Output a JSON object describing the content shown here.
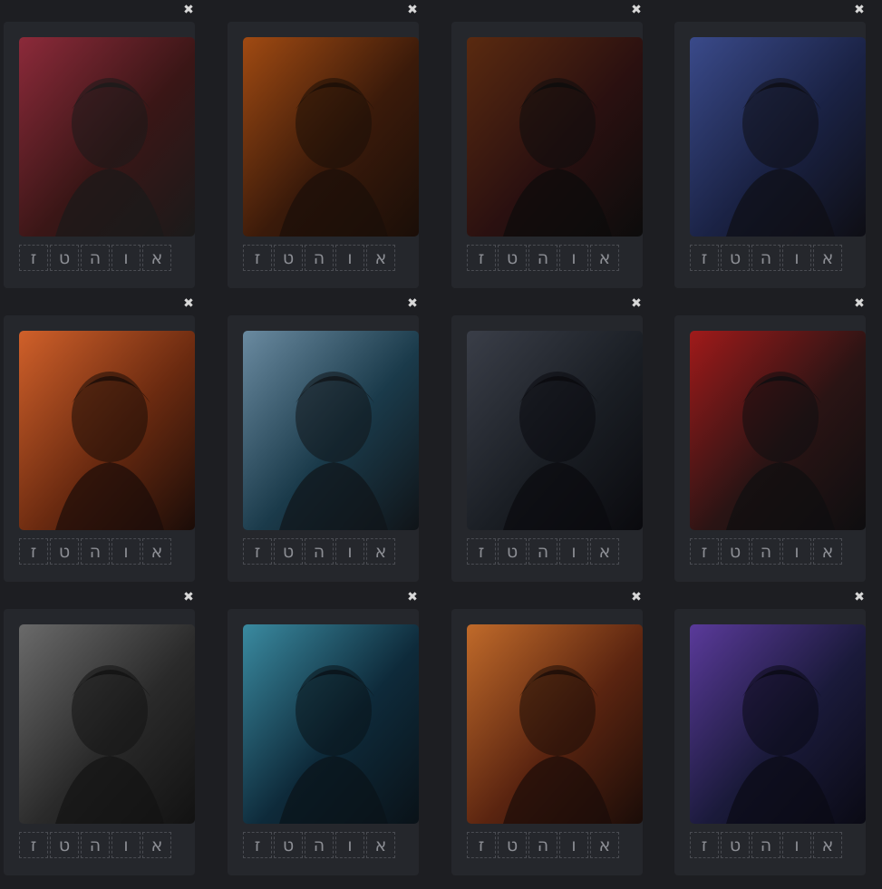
{
  "close_glyph": "✖",
  "key_labels": [
    "ז",
    "ט",
    "ה",
    "ו",
    "א"
  ],
  "cards": [
    {
      "palette": [
        "#3a1616",
        "#8c2a3a",
        "#1a1a1a"
      ],
      "icon": "character-portrait-icon"
    },
    {
      "palette": [
        "#3a1a0a",
        "#a04a12",
        "#1a0e08"
      ],
      "icon": "character-portrait-icon"
    },
    {
      "palette": [
        "#2a1010",
        "#5a2a10",
        "#0c0c0c"
      ],
      "icon": "character-portrait-icon"
    },
    {
      "palette": [
        "#1a2244",
        "#3a4a8a",
        "#0e0e14"
      ],
      "icon": "character-portrait-icon"
    },
    {
      "palette": [
        "#6a2a10",
        "#d0602a",
        "#1a0c08"
      ],
      "icon": "character-portrait-icon"
    },
    {
      "palette": [
        "#1a3a4a",
        "#6a8aa0",
        "#101418"
      ],
      "icon": "character-portrait-icon"
    },
    {
      "palette": [
        "#1a1e24",
        "#3a3e48",
        "#0a0a0e"
      ],
      "icon": "character-portrait-icon"
    },
    {
      "palette": [
        "#2a1414",
        "#a01a1a",
        "#0e0e10"
      ],
      "icon": "character-portrait-icon"
    },
    {
      "palette": [
        "#2a2a2a",
        "#6a6a6a",
        "#121212"
      ],
      "icon": "character-portrait-icon"
    },
    {
      "palette": [
        "#0e2a3a",
        "#3a8aa0",
        "#0a1218"
      ],
      "icon": "character-portrait-icon"
    },
    {
      "palette": [
        "#5a2410",
        "#c06a2a",
        "#1a0c08"
      ],
      "icon": "character-portrait-icon"
    },
    {
      "palette": [
        "#1a1a3a",
        "#5a3a9a",
        "#0a0a14"
      ],
      "icon": "character-portrait-icon"
    }
  ]
}
